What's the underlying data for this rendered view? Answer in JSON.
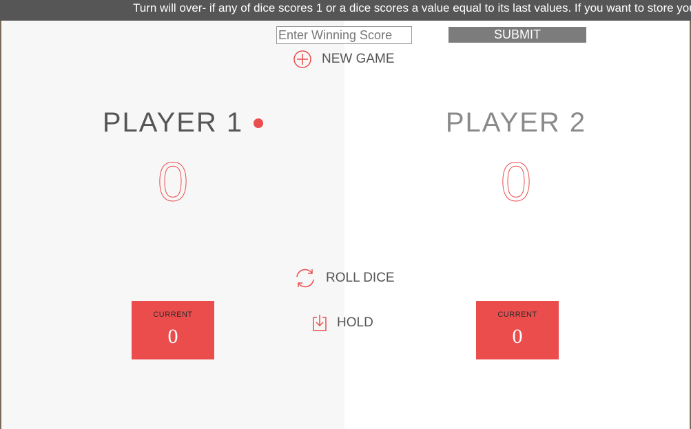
{
  "banner": {
    "text": "Turn will over- if any of dice scores 1 or a dice scores a value equal to its last values. If you want to store your"
  },
  "controls": {
    "winning_score_placeholder": "Enter Winning Score",
    "winning_score_value": "",
    "submit_label": "SUBMIT",
    "new_game_label": "NEW GAME",
    "roll_dice_label": "ROLL DICE",
    "hold_label": "HOLD"
  },
  "players": [
    {
      "name": "PLAYER 1",
      "score": "0",
      "current_label": "CURRENT",
      "current": "0",
      "active": true
    },
    {
      "name": "PLAYER 2",
      "score": "0",
      "current_label": "CURRENT",
      "current": "0",
      "active": false
    }
  ],
  "colors": {
    "accent": "#eb4d4d",
    "banner_bg": "#565656",
    "submit_bg": "#7c7c7c",
    "panel_left_bg": "#f7f7f7",
    "panel_right_bg": "#ffffff"
  },
  "icons": {
    "new_game": "plus-circle-icon",
    "roll_dice": "refresh-icon",
    "hold": "download-icon",
    "active": "active-player-dot"
  }
}
